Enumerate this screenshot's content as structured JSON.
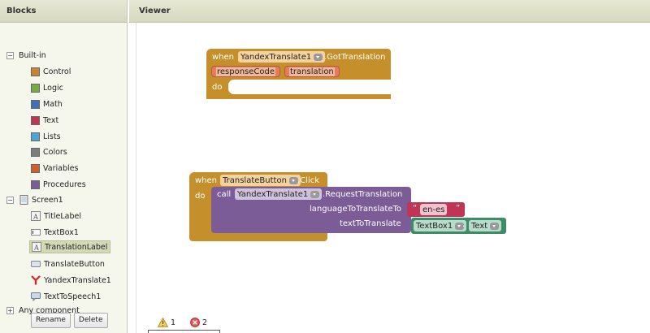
{
  "blocks_panel": {
    "title": "Blocks",
    "builtin": {
      "toggle": "−",
      "label": "Built-in",
      "items": [
        {
          "label": "Control",
          "color": "#c88330"
        },
        {
          "label": "Logic",
          "color": "#77ab41"
        },
        {
          "label": "Math",
          "color": "#3f71b5"
        },
        {
          "label": "Text",
          "color": "#c03456"
        },
        {
          "label": "Lists",
          "color": "#49a6d4"
        },
        {
          "label": "Colors",
          "color": "#7d7d7d"
        },
        {
          "label": "Variables",
          "color": "#d05f2d"
        },
        {
          "label": "Procedures",
          "color": "#7c5c96"
        }
      ]
    },
    "screen": {
      "toggle": "−",
      "label": "Screen1",
      "items": [
        {
          "label": "TitleLabel",
          "icon": "label-icon"
        },
        {
          "label": "TextBox1",
          "icon": "textbox-icon"
        },
        {
          "label": "TranslationLabel",
          "icon": "label-icon",
          "selected": true
        },
        {
          "label": "TranslateButton",
          "icon": "button-icon"
        },
        {
          "label": "YandexTranslate1",
          "icon": "yandex-icon"
        },
        {
          "label": "TextToSpeech1",
          "icon": "speech-icon"
        }
      ]
    },
    "any": {
      "toggle": "+",
      "label": "Any component"
    },
    "rename_label": "Rename",
    "delete_label": "Delete"
  },
  "viewer": {
    "title": "Viewer",
    "got_translation": {
      "when": "when",
      "component": "YandexTranslate1",
      "event": ".GotTranslation",
      "params": [
        "responseCode",
        "translation"
      ],
      "do": "do"
    },
    "click_event": {
      "when": "when",
      "component": "TranslateButton",
      "event": ".Click",
      "do": "do",
      "call": "call",
      "call_component": "YandexTranslate1",
      "method": ".RequestTranslation",
      "arg1_label": "languageToTranslateTo",
      "arg1_value": "en-es",
      "arg2_label": "textToTranslate",
      "arg2_component": "TextBox1",
      "arg2_dot": ".",
      "arg2_property": "Text"
    },
    "warnings": "1",
    "errors": "2"
  }
}
